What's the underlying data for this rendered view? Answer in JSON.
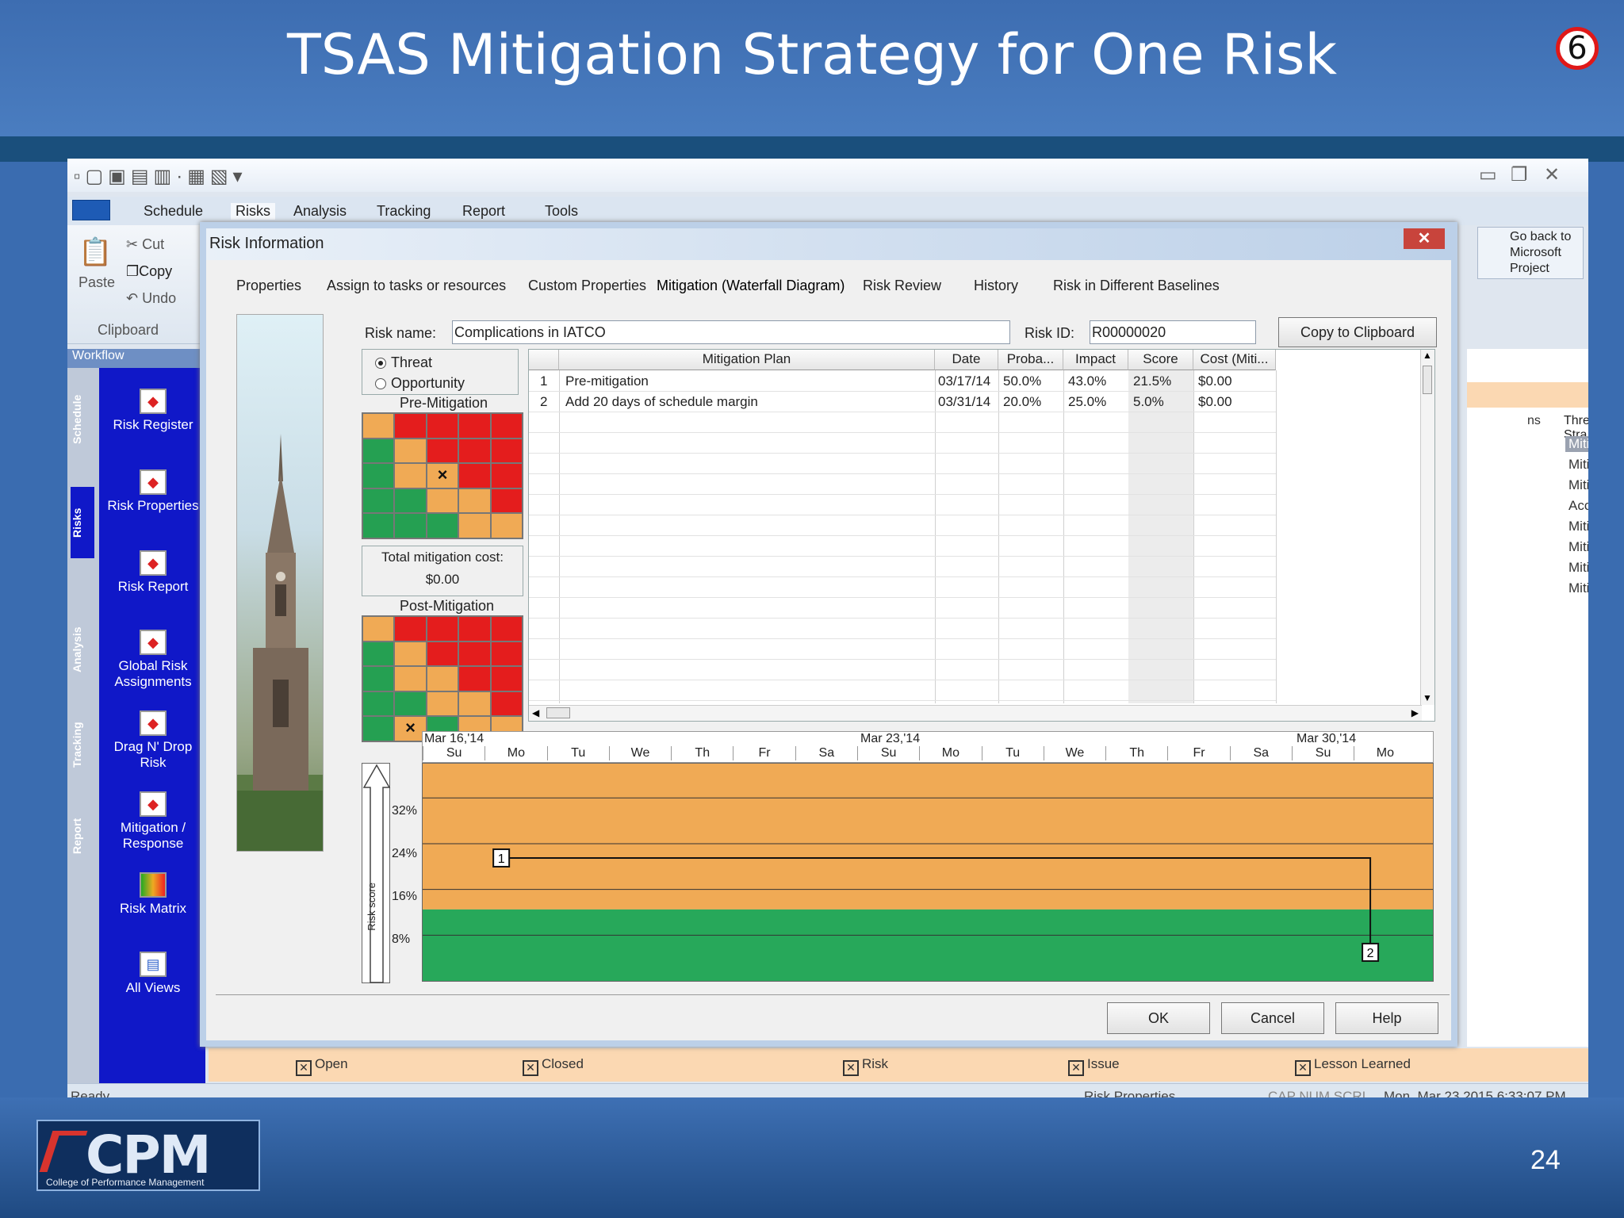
{
  "slide": {
    "title": "TSAS Mitigation Strategy for One Risk",
    "badge": "6",
    "page_number": "24",
    "logo_text": "CPM",
    "logo_sub": "College of Performance Management"
  },
  "app": {
    "quick_access": "▫▢▣▤▥·▦▧▾",
    "ribbon_tabs": [
      "Schedule",
      "Risks",
      "Analysis",
      "Tracking",
      "Report",
      "Tools"
    ],
    "clipboard": {
      "paste": "Paste",
      "cut": "Cut",
      "copy": "Copy",
      "undo": "Undo",
      "group": "Clipboard"
    },
    "workflow": {
      "header": "Workflow",
      "side_tabs": [
        "Schedule",
        "Risks",
        "Analysis",
        "Tracking",
        "Report"
      ],
      "items": [
        "Risk Register",
        "Risk Properties",
        "Risk Report",
        "Global Risk Assignments",
        "Drag N' Drop Risk",
        "Mitigation / Response",
        "Risk Matrix",
        "All Views"
      ]
    },
    "go_back": "Go back to Microsoft Project",
    "right_pane": {
      "col_partial": "ns",
      "header": "Threat Stra",
      "values": [
        "Mitigate",
        "Mitigate",
        "Mitigate",
        "Accept",
        "Mitigate",
        "Mitigate",
        "Mitigate",
        "Mitigate"
      ]
    },
    "legend": [
      "Open",
      "Closed",
      "Risk",
      "Issue",
      "Lesson Learned"
    ],
    "status": {
      "left": "Ready",
      "mid": "Risk Properties",
      "flags": "CAP NUM SCRL",
      "datetime": "Mon, Mar 23,2015 6:33:07 PM"
    }
  },
  "dialog": {
    "title": "Risk Information",
    "tabs": [
      "Properties",
      "Assign to tasks or resources",
      "Custom Properties",
      "Mitigation (Waterfall Diagram)",
      "Risk Review",
      "History",
      "Risk in Different Baselines"
    ],
    "active_tab": "Mitigation (Waterfall Diagram)",
    "risk_name_label": "Risk name:",
    "risk_name": "Complications in IATCO",
    "risk_id_label": "Risk ID:",
    "risk_id": "R00000020",
    "copy_button": "Copy to Clipboard",
    "threat": "Threat",
    "opportunity": "Opportunity",
    "pre_mitigation": "Pre-Mitigation",
    "post_mitigation": "Post-Mitigation",
    "total_cost_label": "Total mitigation cost:",
    "total_cost": "$0.00",
    "matrix_pre": [
      [
        "o",
        "r",
        "r",
        "r",
        "r"
      ],
      [
        "g",
        "o",
        "r",
        "r",
        "r"
      ],
      [
        "g",
        "o",
        "x",
        "r",
        "r"
      ],
      [
        "g",
        "g",
        "o",
        "o",
        "r"
      ],
      [
        "g",
        "g",
        "g",
        "o",
        "o"
      ]
    ],
    "matrix_post": [
      [
        "o",
        "r",
        "r",
        "r",
        "r"
      ],
      [
        "g",
        "o",
        "r",
        "r",
        "r"
      ],
      [
        "g",
        "o",
        "o",
        "r",
        "r"
      ],
      [
        "g",
        "g",
        "o",
        "o",
        "r"
      ],
      [
        "g",
        "x",
        "g",
        "o",
        "o"
      ]
    ],
    "mark": "×",
    "table": {
      "headers": [
        "",
        "Mitigation Plan",
        "Date",
        "Proba...",
        "Impact",
        "Score",
        "Cost (Miti..."
      ],
      "rows": [
        [
          "1",
          "Pre-mitigation",
          "03/17/14",
          "50.0%",
          "43.0%",
          "21.5%",
          "$0.00"
        ],
        [
          "2",
          "Add 20 days of schedule margin",
          "03/31/14",
          "20.0%",
          "25.0%",
          "5.0%",
          "$0.00"
        ]
      ]
    },
    "waterfall": {
      "y_axis_label": "Risk score",
      "y_ticks": [
        "32%",
        "24%",
        "16%",
        "8%"
      ],
      "weeks": [
        "Mar 16,'14",
        "Mar 23,'14",
        "Mar 30,'14"
      ],
      "days": [
        "Su",
        "Mo",
        "Tu",
        "We",
        "Th",
        "Fr",
        "Sa",
        "Su",
        "Mo",
        "Tu",
        "We",
        "Th",
        "Fr",
        "Sa",
        "Su",
        "Mo"
      ],
      "points": [
        {
          "label": "1",
          "day_index": 0.5,
          "score": 21.5
        },
        {
          "label": "2",
          "day_index": 14.5,
          "score": 5.0
        }
      ],
      "colors": {
        "orange": "#f0aa55",
        "green": "#27a85a"
      }
    },
    "buttons": {
      "ok": "OK",
      "cancel": "Cancel",
      "help": "Help"
    }
  }
}
